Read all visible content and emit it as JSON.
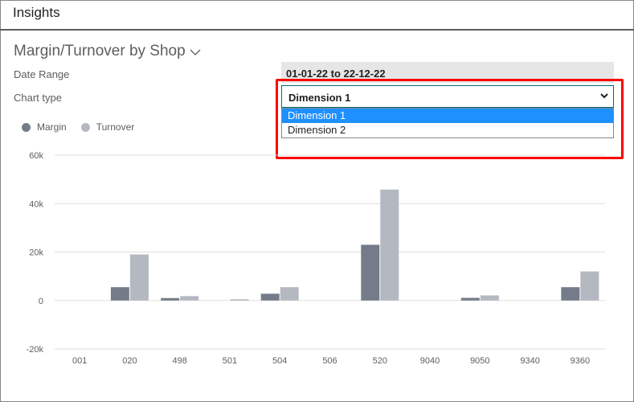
{
  "header": {
    "title": "Insights"
  },
  "part": {
    "title": "Margin/Turnover by Shop"
  },
  "filters": {
    "date_range_label": "Date Range",
    "date_range_value": "01-01-22 to 22-12-22",
    "chart_type_label": "Chart type",
    "chart_type_value": "Dimension 1",
    "options": [
      "Dimension 1",
      "Dimension 2"
    ]
  },
  "colors": {
    "margin": "#737c88",
    "turnover": "#b4b8c1",
    "accent": "#006b75",
    "selected": "#1e90ff",
    "highlight": "#ff0000"
  },
  "chart_data": {
    "type": "bar",
    "categories": [
      "001",
      "020",
      "498",
      "501",
      "504",
      "506",
      "520",
      "9040",
      "9050",
      "9340",
      "9360"
    ],
    "series": [
      {
        "name": "Margin",
        "values": [
          0,
          5500,
          1000,
          0,
          2800,
          0,
          23000,
          0,
          1100,
          0,
          5500
        ]
      },
      {
        "name": "Turnover",
        "values": [
          0,
          19000,
          1800,
          500,
          5500,
          0,
          45800,
          0,
          2100,
          0,
          12000
        ]
      }
    ],
    "ylim": [
      -20000,
      60000
    ],
    "yticks": [
      {
        "value": -20000,
        "label": "-20k"
      },
      {
        "value": 0,
        "label": "0"
      },
      {
        "value": 20000,
        "label": "20k"
      },
      {
        "value": 40000,
        "label": "40k"
      },
      {
        "value": 60000,
        "label": "60k"
      }
    ],
    "grid": true,
    "legend": "top-left"
  }
}
